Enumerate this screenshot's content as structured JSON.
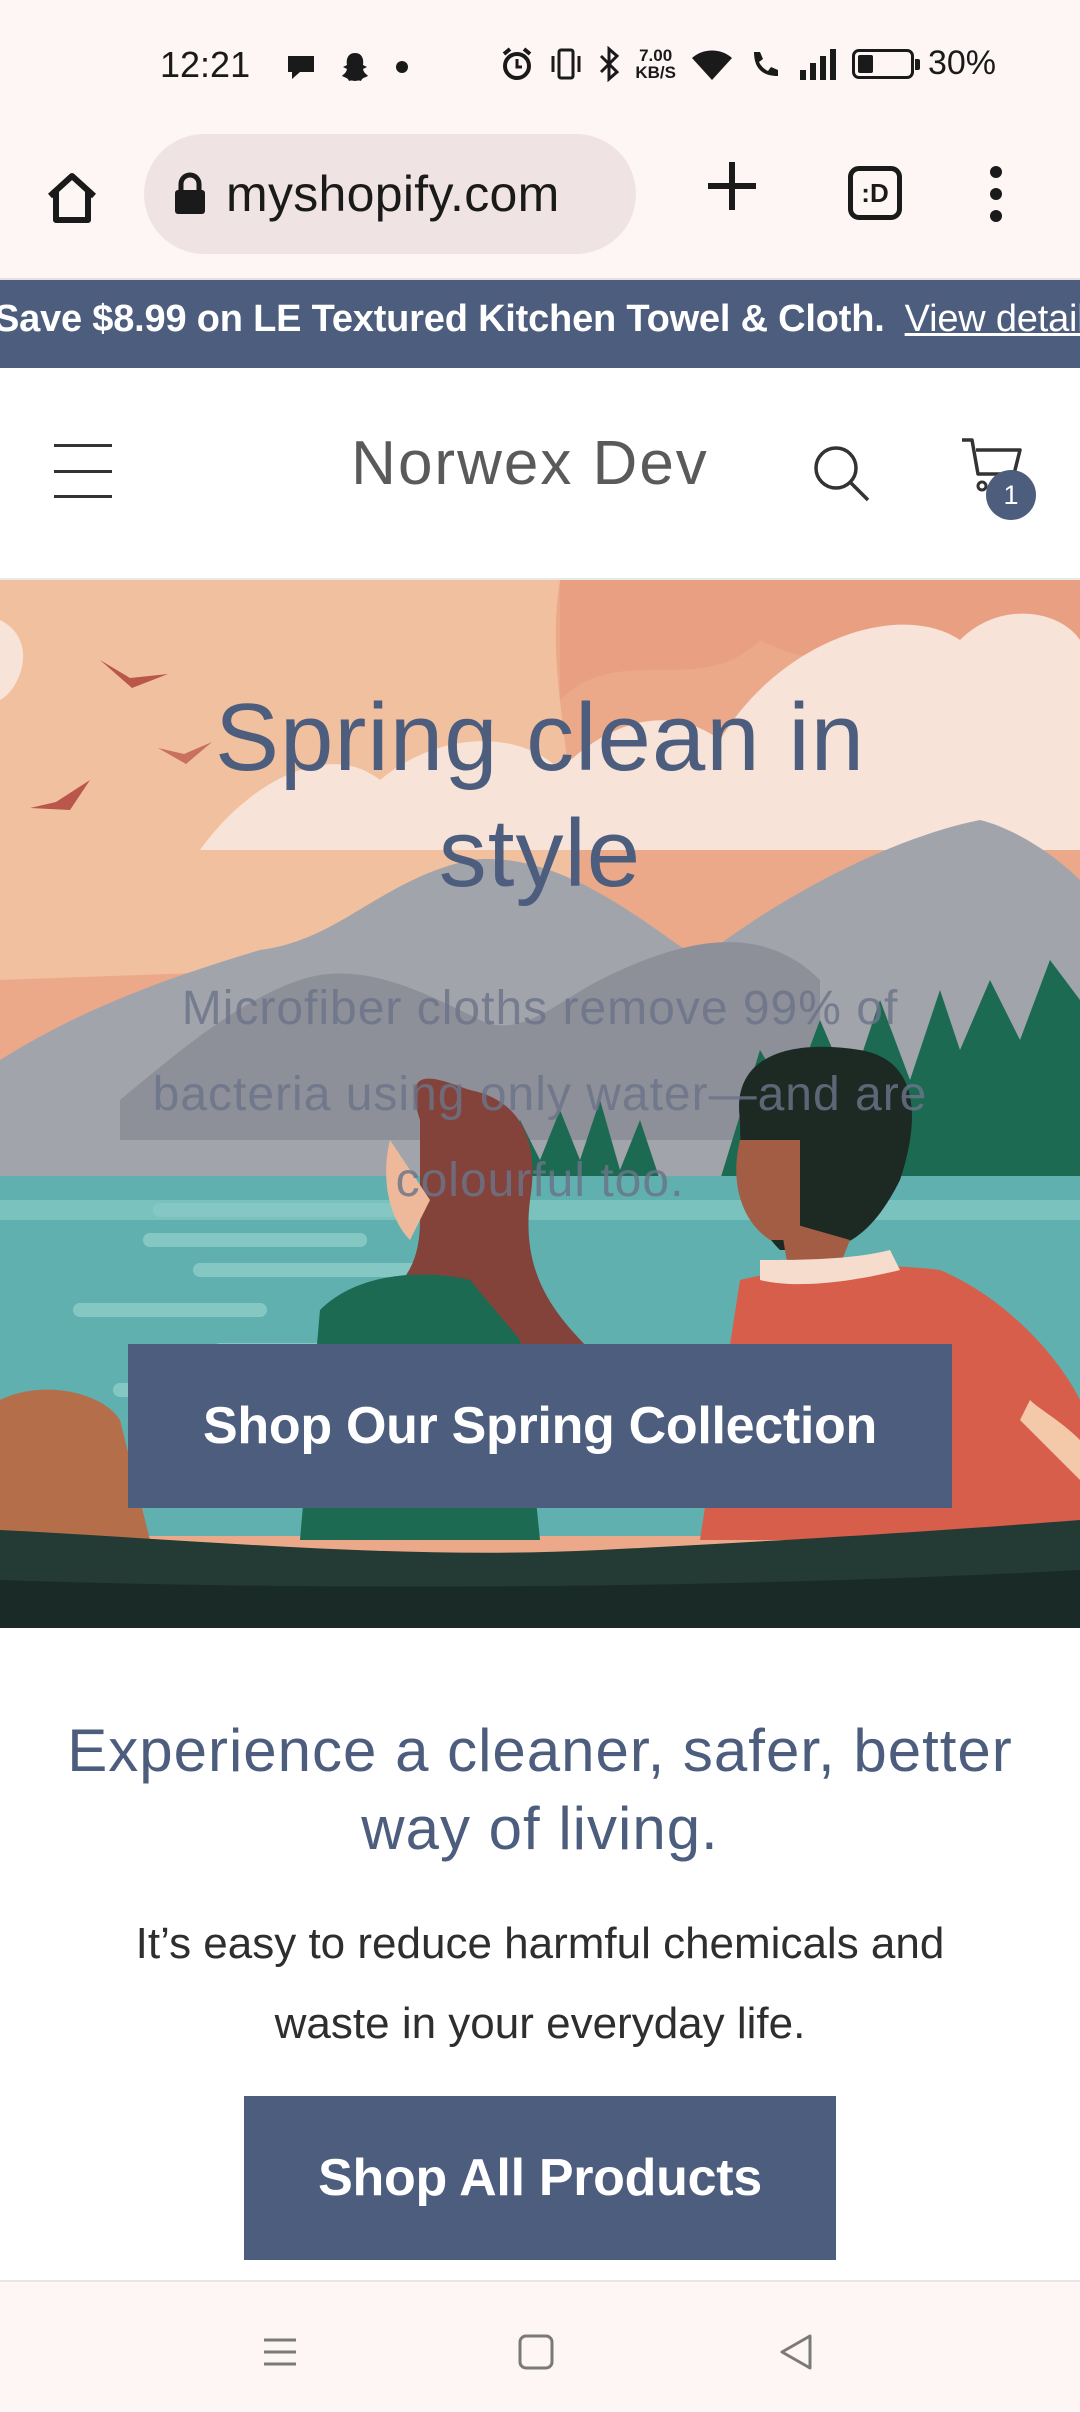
{
  "status_bar": {
    "time": "12:21",
    "net_speed_value": "7.00",
    "net_speed_unit": "KB/S",
    "battery": "30%",
    "battery_level": 0.3,
    "left_icons": [
      "message-icon",
      "snapchat-icon",
      "dot-icon"
    ],
    "right_icons": [
      "alarm-icon",
      "vibrate-icon",
      "bluetooth-icon",
      "wifi-icon",
      "wifi-call-icon",
      "signal-icon",
      "battery-icon"
    ]
  },
  "browser": {
    "url": "myshopify.com",
    "tabs_label": ":D"
  },
  "announcement": {
    "text": "Save $8.99 on LE Textured Kitchen Towel & Cloth.",
    "link": "View details"
  },
  "header": {
    "logo": "Norwex Dev",
    "cart_count": "1"
  },
  "hero": {
    "title": "Spring clean in style",
    "subtitle": "Microfiber cloths remove 99% of bacteria using only water—and are colourful too.",
    "cta": "Shop Our Spring Collection"
  },
  "section": {
    "title": "Experience a cleaner, safer, better way of living.",
    "text": "It’s easy to reduce harmful chemicals and waste in your everyday life.",
    "cta": "Shop All Products"
  },
  "colors": {
    "brand": "#4d5d7e",
    "chrome_bg": "#fdf6f5"
  }
}
